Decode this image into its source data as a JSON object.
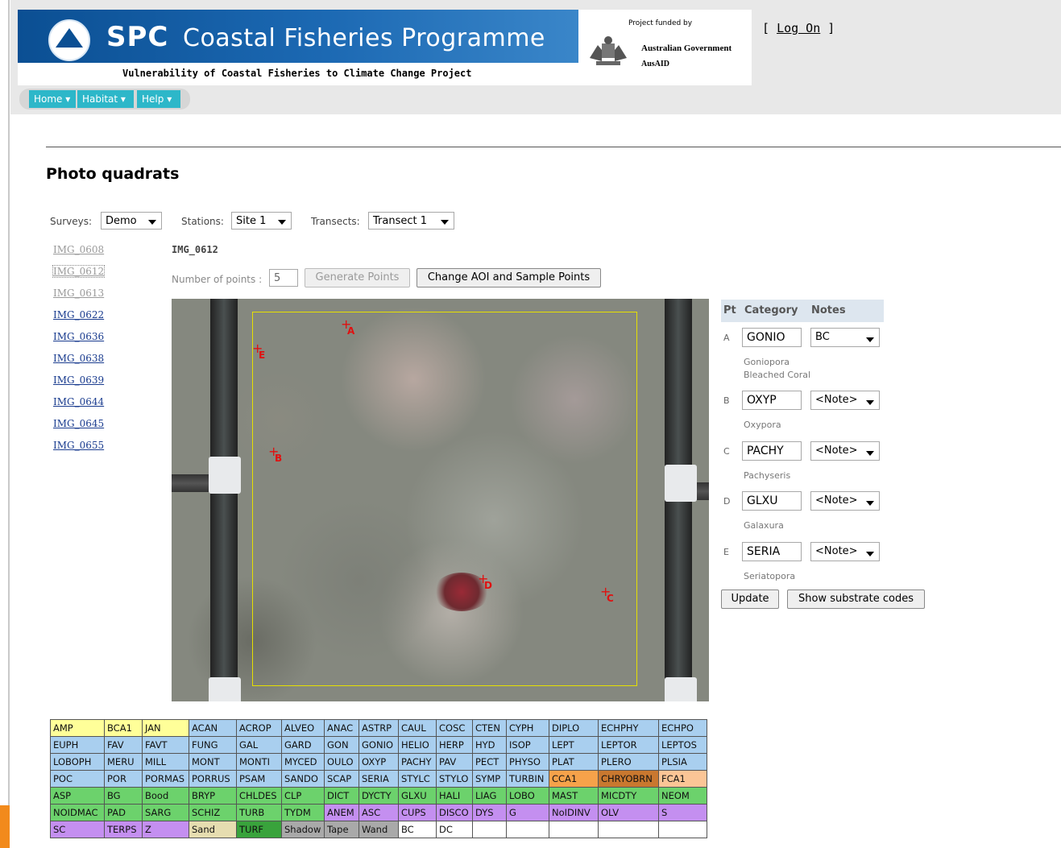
{
  "header": {
    "brand_short": "SPC",
    "brand_title": "Coastal Fisheries Programme",
    "subtitle": "Vulnerability of Coastal Fisheries to Climate Change Project",
    "funded_by": "Project funded by",
    "gov": "Australian Government",
    "agency": "AusAID",
    "logon": "Log On"
  },
  "nav": [
    "Home",
    "Habitat",
    "Help"
  ],
  "page_title": "Photo quadrats",
  "filters": {
    "surveys_label": "Surveys:",
    "surveys_value": "Demo",
    "stations_label": "Stations:",
    "stations_value": "Site 1",
    "transects_label": "Transects:",
    "transects_value": "Transect 1"
  },
  "images": [
    {
      "name": "IMG_0608",
      "state": "visited"
    },
    {
      "name": "IMG_0612",
      "state": "visited"
    },
    {
      "name": "IMG_0613",
      "state": "visited"
    },
    {
      "name": "IMG_0622",
      "state": "link"
    },
    {
      "name": "IMG_0636",
      "state": "link"
    },
    {
      "name": "IMG_0638",
      "state": "link"
    },
    {
      "name": "IMG_0639",
      "state": "link"
    },
    {
      "name": "IMG_0644",
      "state": "link"
    },
    {
      "name": "IMG_0645",
      "state": "link"
    },
    {
      "name": "IMG_0655",
      "state": "link"
    }
  ],
  "current_image": "IMG_0612",
  "points_label": "Number of points :",
  "points_value": "5",
  "generate_button": "Generate Points",
  "change_aoi_button": "Change AOI and Sample Points",
  "point_table": {
    "headers": [
      "Pt",
      "Category",
      "Notes"
    ],
    "rows": [
      {
        "pt": "A",
        "category": "GONIO",
        "note": "BC",
        "desc1": "Goniopora",
        "desc2": "Bleached Coral"
      },
      {
        "pt": "B",
        "category": "OXYP",
        "note": "<Note>",
        "desc1": "Oxypora",
        "desc2": ""
      },
      {
        "pt": "C",
        "category": "PACHY",
        "note": "<Note>",
        "desc1": "Pachyseris",
        "desc2": ""
      },
      {
        "pt": "D",
        "category": "GLXU",
        "note": "<Note>",
        "desc1": "Galaxura",
        "desc2": ""
      },
      {
        "pt": "E",
        "category": "SERIA",
        "note": "<Note>",
        "desc1": "Seriatopora",
        "desc2": ""
      }
    ]
  },
  "update_button": "Update",
  "show_codes_button": "Show substrate codes",
  "photo_points": [
    "A",
    "B",
    "C",
    "D",
    "E"
  ],
  "colors": {
    "nav": "#2db7c9",
    "aoi": "#e6e000",
    "point": "#e01010"
  },
  "substrate_codes": [
    [
      [
        "AMP",
        "y"
      ],
      [
        "BCA1",
        "y"
      ],
      [
        "JAN",
        "y"
      ],
      [
        "ACAN",
        "b"
      ],
      [
        "ACROP",
        "b"
      ],
      [
        "ALVEO",
        "b"
      ],
      [
        "ANAC",
        "b"
      ],
      [
        "ASTRP",
        "b"
      ],
      [
        "CAUL",
        "b"
      ],
      [
        "COSC",
        "b"
      ],
      [
        "CTEN",
        "b"
      ],
      [
        "CYPH",
        "b"
      ],
      [
        "DIPLO",
        "b"
      ],
      [
        "ECHPHY",
        "b"
      ],
      [
        "ECHPO",
        "b"
      ]
    ],
    [
      [
        "EUPH",
        "b"
      ],
      [
        "FAV",
        "b"
      ],
      [
        "FAVT",
        "b"
      ],
      [
        "FUNG",
        "b"
      ],
      [
        "GAL",
        "b"
      ],
      [
        "GARD",
        "b"
      ],
      [
        "GON",
        "b"
      ],
      [
        "GONIO",
        "b"
      ],
      [
        "HELIO",
        "b"
      ],
      [
        "HERP",
        "b"
      ],
      [
        "HYD",
        "b"
      ],
      [
        "ISOP",
        "b"
      ],
      [
        "LEPT",
        "b"
      ],
      [
        "LEPTOR",
        "b"
      ],
      [
        "LEPTOS",
        "b"
      ]
    ],
    [
      [
        "LOBOPH",
        "b"
      ],
      [
        "MERU",
        "b"
      ],
      [
        "MILL",
        "b"
      ],
      [
        "MONT",
        "b"
      ],
      [
        "MONTI",
        "b"
      ],
      [
        "MYCED",
        "b"
      ],
      [
        "OULO",
        "b"
      ],
      [
        "OXYP",
        "b"
      ],
      [
        "PACHY",
        "b"
      ],
      [
        "PAV",
        "b"
      ],
      [
        "PECT",
        "b"
      ],
      [
        "PHYSO",
        "b"
      ],
      [
        "PLAT",
        "b"
      ],
      [
        "PLERO",
        "b"
      ],
      [
        "PLSIA",
        "b"
      ]
    ],
    [
      [
        "POC",
        "b"
      ],
      [
        "POR",
        "b"
      ],
      [
        "PORMAS",
        "b"
      ],
      [
        "PORRUS",
        "b"
      ],
      [
        "PSAM",
        "b"
      ],
      [
        "SANDO",
        "b"
      ],
      [
        "SCAP",
        "b"
      ],
      [
        "SERIA",
        "b"
      ],
      [
        "STYLC",
        "b"
      ],
      [
        "STYLO",
        "b"
      ],
      [
        "SYMP",
        "b"
      ],
      [
        "TURBIN",
        "b"
      ],
      [
        "CCA1",
        "o"
      ],
      [
        "CHRYOBRN",
        "br"
      ],
      [
        "FCA1",
        "pe"
      ]
    ],
    [
      [
        "ASP",
        "g"
      ],
      [
        "BG",
        "g"
      ],
      [
        "Bood",
        "g"
      ],
      [
        "BRYP",
        "g"
      ],
      [
        "CHLDES",
        "g"
      ],
      [
        "CLP",
        "g"
      ],
      [
        "DICT",
        "g"
      ],
      [
        "DYCTY",
        "g"
      ],
      [
        "GLXU",
        "g"
      ],
      [
        "HALI",
        "g"
      ],
      [
        "LIAG",
        "g"
      ],
      [
        "LOBO",
        "g"
      ],
      [
        "MAST",
        "g"
      ],
      [
        "MICDTY",
        "g"
      ],
      [
        "NEOM",
        "g"
      ]
    ],
    [
      [
        "NOIDMAC",
        "g"
      ],
      [
        "PAD",
        "g"
      ],
      [
        "SARG",
        "g"
      ],
      [
        "SCHIZ",
        "g"
      ],
      [
        "TURB",
        "g"
      ],
      [
        "TYDM",
        "g"
      ],
      [
        "ANEM",
        "p"
      ],
      [
        "ASC",
        "p"
      ],
      [
        "CUPS",
        "p"
      ],
      [
        "DISCO",
        "p"
      ],
      [
        "DYS",
        "p"
      ],
      [
        "G",
        "p"
      ],
      [
        "NoIDINV",
        "p"
      ],
      [
        "OLV",
        "p"
      ],
      [
        "S",
        "p"
      ]
    ],
    [
      [
        "SC",
        "p"
      ],
      [
        "TERPS",
        "p"
      ],
      [
        "Z",
        "p"
      ],
      [
        "Sand",
        "t"
      ],
      [
        "TURF",
        "dg"
      ],
      [
        "Shadow",
        "gr"
      ],
      [
        "Tape",
        "gr"
      ],
      [
        "Wand",
        "gr"
      ],
      [
        "BC",
        "w"
      ],
      [
        "DC",
        "w"
      ],
      [
        "",
        "w"
      ],
      [
        "",
        "w"
      ],
      [
        "",
        "w"
      ],
      [
        "",
        "w"
      ],
      [
        "",
        "w"
      ]
    ]
  ]
}
